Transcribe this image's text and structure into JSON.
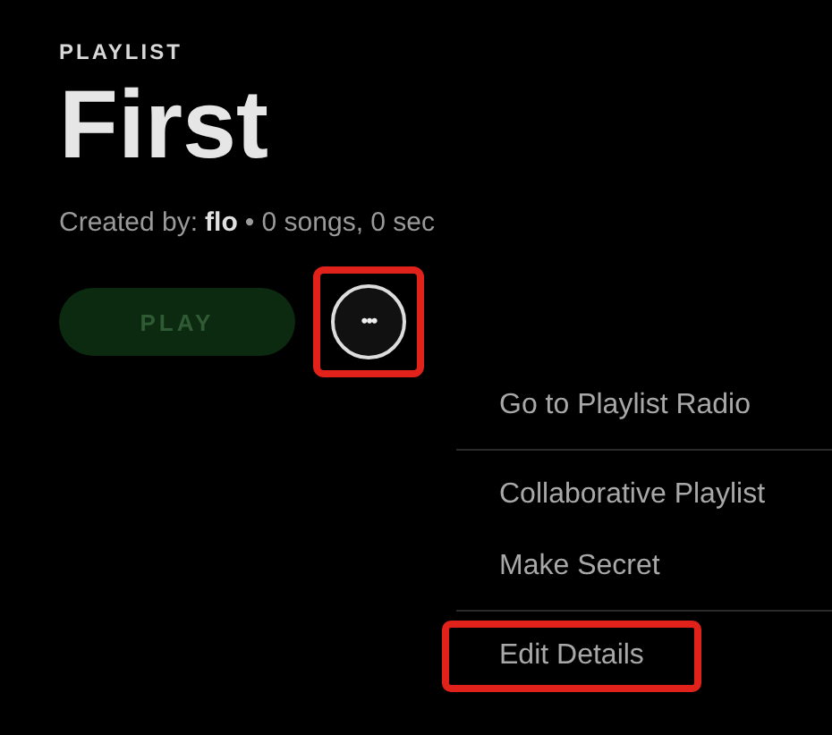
{
  "header": {
    "type_label": "PLAYLIST",
    "title": "First",
    "meta_prefix": "Created by:",
    "owner": "flo",
    "meta_suffix": "• 0 songs, 0 sec"
  },
  "actions": {
    "play": {
      "label": "PLAY",
      "disabled": true
    },
    "more": {
      "label": "•••",
      "highlighted": true
    }
  },
  "menu": {
    "items": [
      {
        "label": "Go to Playlist Radio",
        "divider_after": true,
        "highlighted": false
      },
      {
        "label": "Collaborative Playlist",
        "divider_after": false,
        "highlighted": false
      },
      {
        "label": "Make Secret",
        "divider_after": true,
        "highlighted": false
      },
      {
        "label": "Edit Details",
        "divider_after": false,
        "highlighted": true
      }
    ]
  }
}
